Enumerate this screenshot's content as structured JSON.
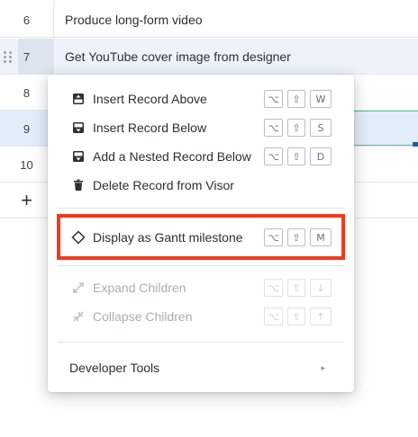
{
  "grid": {
    "rows": [
      {
        "num": "6",
        "text": "Produce long-form video"
      },
      {
        "num": "7",
        "text": "Get YouTube cover image from designer"
      },
      {
        "num": "8",
        "text": ""
      },
      {
        "num": "9",
        "text": ""
      },
      {
        "num": "10",
        "text": ""
      }
    ],
    "add_row_label": "+"
  },
  "menu": {
    "items": [
      {
        "label": "Insert Record Above",
        "icon": "insert-above-icon",
        "keys": [
          "⌥",
          "⇧",
          "W"
        ]
      },
      {
        "label": "Insert Record Below",
        "icon": "insert-below-icon",
        "keys": [
          "⌥",
          "⇧",
          "S"
        ]
      },
      {
        "label": "Add a Nested Record Below",
        "icon": "nested-record-icon",
        "keys": [
          "⌥",
          "⇧",
          "D"
        ]
      },
      {
        "label": "Delete Record from Visor",
        "icon": "trash-icon",
        "keys": []
      },
      {
        "label": "Display as Gantt milestone",
        "icon": "diamond-icon",
        "keys": [
          "⌥",
          "⇧",
          "M"
        ]
      },
      {
        "label": "Expand Children",
        "icon": "expand-icon",
        "keys": [
          "⌥",
          "⇧",
          "↓"
        ],
        "disabled": true
      },
      {
        "label": "Collapse Children",
        "icon": "collapse-icon",
        "keys": [
          "⌥",
          "⇧",
          "↑"
        ],
        "disabled": true
      },
      {
        "label": "Developer Tools",
        "icon": "chevron-right-icon",
        "keys": []
      }
    ],
    "submenu_arrow": "▸"
  },
  "colors": {
    "highlight_border": "#f03a1c",
    "selected_row": "#e3edf9",
    "cell_outline": "#3fcf9f"
  }
}
